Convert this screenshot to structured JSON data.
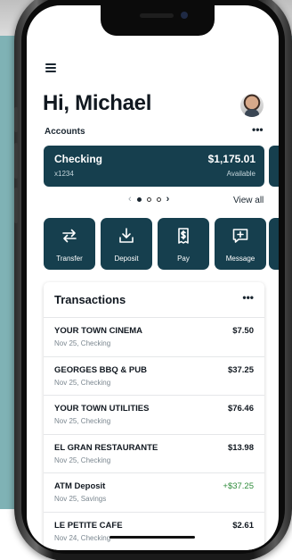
{
  "greeting": "Hi, Michael",
  "accounts": {
    "label": "Accounts",
    "more": "•••",
    "card": {
      "name": "Checking",
      "number": "x1234",
      "balance": "$1,175.01",
      "balance_label": "Available"
    },
    "pager": {
      "prev": "‹",
      "next": "›",
      "pages": 3,
      "active_page": 1
    },
    "view_all": "View all"
  },
  "actions": [
    {
      "label": "Transfer",
      "icon": "transfer-icon"
    },
    {
      "label": "Deposit",
      "icon": "deposit-icon"
    },
    {
      "label": "Pay",
      "icon": "pay-icon"
    },
    {
      "label": "Message",
      "icon": "message-icon"
    }
  ],
  "transactions": {
    "title": "Transactions",
    "more": "•••",
    "items": [
      {
        "name": "YOUR TOWN CINEMA",
        "detail": "Nov 25, Checking",
        "amount": "$7.50"
      },
      {
        "name": "GEORGES BBQ & PUB",
        "detail": "Nov 25, Checking",
        "amount": "$37.25"
      },
      {
        "name": "YOUR TOWN UTILITIES",
        "detail": "Nov 25, Checking",
        "amount": "$76.46"
      },
      {
        "name": "EL GRAN RESTAURANTE",
        "detail": "Nov 25, Checking",
        "amount": "$13.98"
      },
      {
        "name": "ATM Deposit",
        "detail": "Nov 25, Savings",
        "amount": "+$37.25"
      },
      {
        "name": "LE PETITE CAFE",
        "detail": "Nov 24, Checking",
        "amount": "$2.61"
      }
    ]
  },
  "colors": {
    "primary": "#163f4e",
    "credit": "#2e8b3a",
    "backdrop": "#7fb2b5"
  }
}
